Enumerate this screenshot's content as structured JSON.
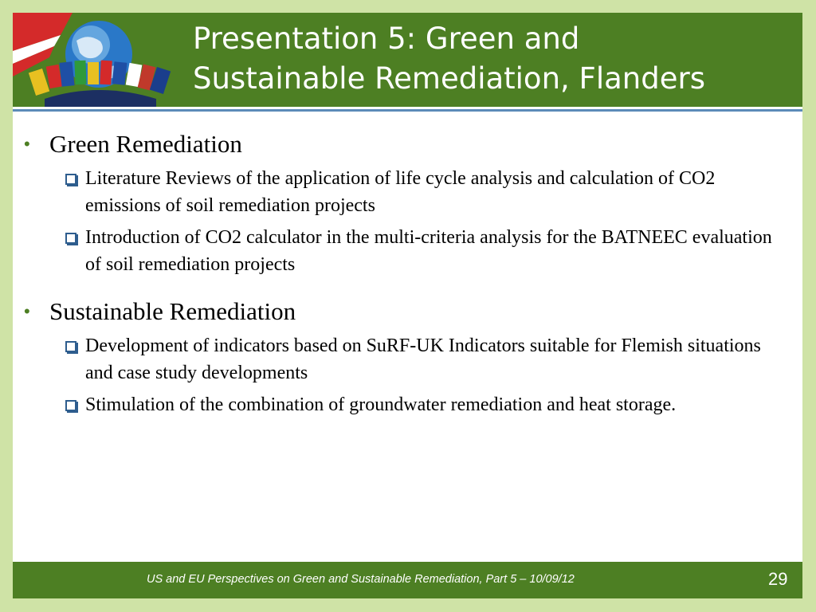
{
  "slide": {
    "title_lines": [
      "Presentation 5: Green and",
      "Sustainable Remediation, Flanders"
    ],
    "sections": [
      {
        "heading": "Green Remediation",
        "items": [
          "Literature Reviews of the application of life cycle analysis and calculation of CO2 emissions of soil remediation projects",
          "Introduction of CO2 calculator in the multi-criteria analysis for the BATNEEC evaluation of soil remediation projects"
        ]
      },
      {
        "heading": "Sustainable Remediation",
        "items": [
          "Development of indicators based on SuRF-UK Indicators suitable for Flemish situations and case study developments",
          "Stimulation of the combination of groundwater remediation and heat storage."
        ]
      }
    ],
    "footer_text": "US and EU Perspectives on Green and Sustainable Remediation, Part 5 – 10/09/12",
    "page_number": "29"
  },
  "logo": {
    "icon": "globe-with-flags-logo"
  },
  "colors": {
    "background": "#cfe3a6",
    "header": "#4d7f23",
    "bullet": "#4d7f23",
    "checkbox": "#2e5d8e"
  }
}
